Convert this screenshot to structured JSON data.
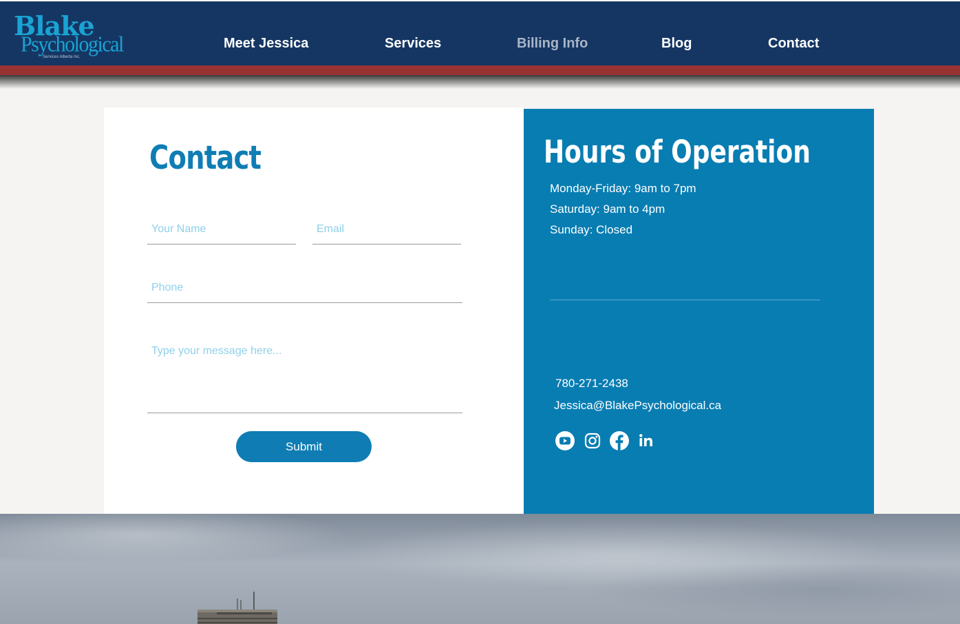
{
  "logo": {
    "line1": "Blake",
    "line2": "Psychological",
    "subline": "Services Alberta Inc."
  },
  "nav": {
    "items": [
      {
        "label": "Meet Jessica"
      },
      {
        "label": "Services"
      },
      {
        "label": "Billing Info",
        "active": true
      },
      {
        "label": "Blog"
      },
      {
        "label": "Contact"
      }
    ]
  },
  "contact_form": {
    "title": "Contact",
    "name_placeholder": "Your Name",
    "email_placeholder": "Email",
    "phone_placeholder": "Phone",
    "message_placeholder": "Type your message here...",
    "submit_label": "Submit"
  },
  "hours": {
    "title": "Hours of Operation",
    "lines": [
      "Monday-Friday: 9am to 7pm",
      "Saturday: 9am to 4pm",
      "Sunday: Closed"
    ],
    "phone": "780-271-2438",
    "email": "Jessica@BlakePsychological.ca",
    "social": [
      "youtube-icon",
      "instagram-icon",
      "facebook-icon",
      "linkedin-icon"
    ]
  },
  "colors": {
    "header_bg": "#153663",
    "accent_red": "#993333",
    "brand_blue": "#0f7db4",
    "panel_blue": "#087db2",
    "logo_cyan": "#1aa3d4"
  }
}
